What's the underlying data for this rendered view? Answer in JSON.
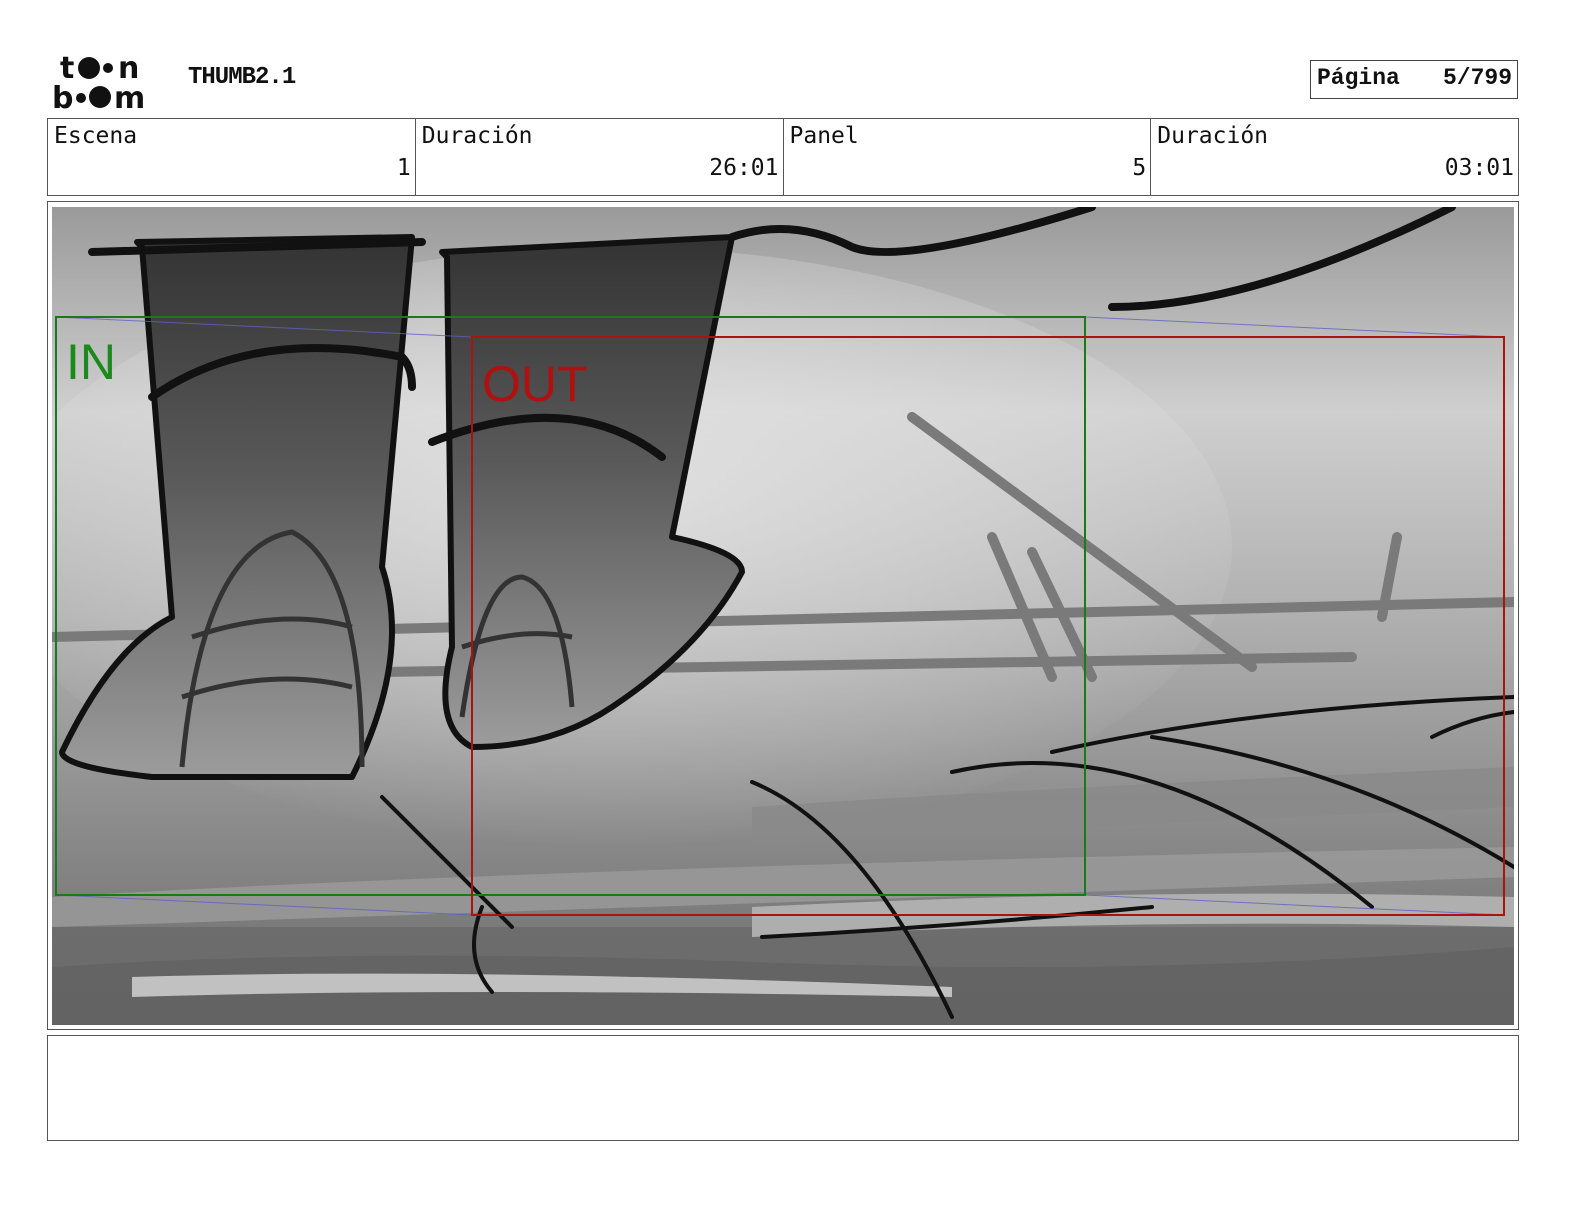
{
  "header": {
    "logo_text": "toonboom",
    "project": "THUMB2.1",
    "page_label": "Página",
    "page_value": "5/799"
  },
  "info": {
    "scene_label": "Escena",
    "scene_value": "1",
    "scene_duration_label": "Duración",
    "scene_duration_value": "26:01",
    "panel_label": "Panel",
    "panel_value": "5",
    "panel_duration_label": "Duración",
    "panel_duration_value": "03:01"
  },
  "panel": {
    "in_label": "IN",
    "out_label": "OUT",
    "in_color": "#1a8a1a",
    "out_color": "#b01010"
  },
  "notes": ""
}
